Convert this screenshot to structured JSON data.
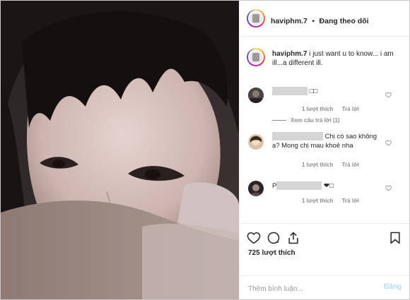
{
  "post": {
    "username": "haviphm.7",
    "follow_status": "Đang theo dõi",
    "caption_user": "haviphm.7",
    "caption_text": "i just want u to know... i am ill...a different ill."
  },
  "comments": [
    {
      "text_tail": "□□",
      "likes": "1 lượt thích",
      "reply": "Trả lời",
      "view_replies": "Xem câu trả lời (1)"
    },
    {
      "text_tail": "Chị có sao không ạ? Mong chị mau khoẻ nha",
      "likes": "1 lượt thích",
      "reply": "Trả lời"
    },
    {
      "text_lead": "P",
      "text_tail": "❤□",
      "likes": "1 lượt thích",
      "reply": "Trả lời"
    }
  ],
  "actions": {
    "likes_count": "725 lượt thích",
    "icons": [
      "heart-icon",
      "comment-icon",
      "share-icon",
      "bookmark-icon"
    ]
  },
  "add_comment": {
    "placeholder": "Thêm bình luận...",
    "post_label": "Đăng"
  },
  "colors": {
    "text": "#262626",
    "muted": "#8e8e8e",
    "post_button_disabled": "#b3dbff",
    "border": "#efefef"
  }
}
